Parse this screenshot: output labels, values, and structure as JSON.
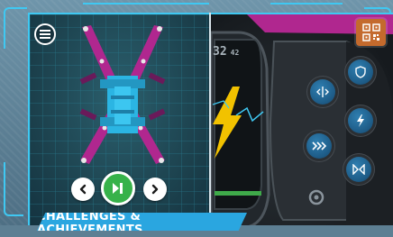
{
  "speed": {
    "value": "32",
    "unit": "42"
  },
  "banner": {
    "label": "CHALLENGES & ACHIEVEMENTS"
  },
  "controls": {
    "prev_icon": "chevron-left-icon",
    "play_icon": "play-step-icon",
    "next_icon": "chevron-right-icon",
    "menu_icon": "hamburger-menu-icon",
    "scan_icon": "qr-code-icon",
    "controller_buttons": [
      "shield-icon",
      "steer-icon",
      "lightning-icon",
      "speed-chevrons-icon",
      "bowtie-icon",
      "spin-icon"
    ]
  },
  "colors": {
    "accent": "#3fc8f2",
    "play": "#37b24a",
    "robot_arms": "#b0278f",
    "robot_body": "#2bb5e3",
    "scan_button": "#c46a2d",
    "controller_buttons": "#1d5a85",
    "lightning": "#f2c200",
    "banner": "#2aa6e0"
  }
}
